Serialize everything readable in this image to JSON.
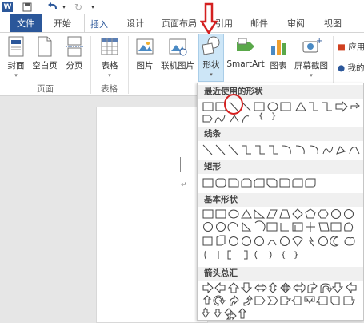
{
  "qat": {
    "word_logo": "W",
    "save_icon": "save-icon",
    "undo_icon": "undo-icon",
    "redo_icon": "redo-icon"
  },
  "tabs": [
    "文件",
    "开始",
    "插入",
    "设计",
    "页面布局",
    "引用",
    "邮件",
    "审阅",
    "视图"
  ],
  "active_tab": "插入",
  "ribbon": {
    "pages_group": {
      "label": "页面",
      "buttons": [
        "封面",
        "空白页",
        "分页"
      ]
    },
    "tables_group": {
      "label": "表格",
      "buttons": [
        "表格"
      ]
    },
    "illustrations": {
      "buttons": [
        "图片",
        "联机图片",
        "形状",
        "SmartArt",
        "图表",
        "屏幕截图"
      ]
    },
    "edge": [
      "应用",
      "我的"
    ]
  },
  "shapes_menu": {
    "sections": [
      "最近使用的形状",
      "线条",
      "矩形",
      "基本形状",
      "箭头总汇"
    ],
    "recent_text_glyphs": [
      "{",
      "}"
    ],
    "basic_text_glyphs": [
      "{",
      "}"
    ]
  },
  "colors": {
    "accent": "#2b579a",
    "annotation": "#d42020",
    "selected_btn": "#cde6f7"
  }
}
